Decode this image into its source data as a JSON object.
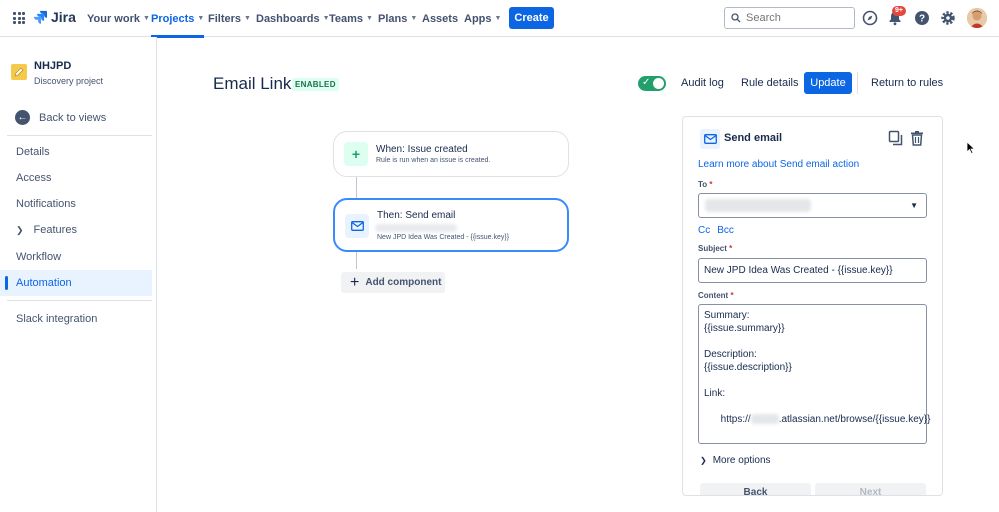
{
  "nav": {
    "brand": "Jira",
    "items": [
      {
        "label": "Your work",
        "dropdown": true
      },
      {
        "label": "Projects",
        "dropdown": true,
        "active": true
      },
      {
        "label": "Filters",
        "dropdown": true
      },
      {
        "label": "Dashboards",
        "dropdown": true
      },
      {
        "label": "Teams",
        "dropdown": true
      },
      {
        "label": "Plans",
        "dropdown": true
      },
      {
        "label": "Assets",
        "dropdown": false
      },
      {
        "label": "Apps",
        "dropdown": true
      }
    ],
    "create_label": "Create",
    "search_placeholder": "Search",
    "notification_badge": "9+",
    "icons": [
      "app-switcher-icon",
      "compass-icon",
      "bell-icon",
      "help-icon",
      "settings-icon"
    ]
  },
  "sidebar": {
    "project_name": "NHJPD",
    "project_type": "Discovery project",
    "back_label": "Back to views",
    "items": [
      {
        "label": "Details"
      },
      {
        "label": "Access"
      },
      {
        "label": "Notifications"
      },
      {
        "label": "Features",
        "expandable": true
      },
      {
        "label": "Workflow"
      },
      {
        "label": "Automation",
        "active": true
      }
    ],
    "integration_label": "Slack integration"
  },
  "rule": {
    "title": "Email Link",
    "status": "ENABLED",
    "enabled": true,
    "actions": {
      "audit_log": "Audit log",
      "rule_details": "Rule details",
      "update": "Update",
      "return": "Return to rules"
    }
  },
  "flow": {
    "trigger": {
      "title": "When: Issue created",
      "subtitle": "Rule is run when an issue is created."
    },
    "action": {
      "title": "Then: Send email",
      "subtitle": "New JPD Idea Was Created - {{issue.key}}"
    },
    "add_label": "Add component"
  },
  "panel": {
    "title": "Send email",
    "learn_more": "Learn more about Send email action",
    "to_label": "To",
    "cc_label": "Cc",
    "bcc_label": "Bcc",
    "subject_label": "Subject",
    "subject_value": "New JPD Idea Was Created - {{issue.key}}",
    "content_label": "Content",
    "content": {
      "line1": "Summary:",
      "line2": "{{issue.summary}}",
      "line3": "",
      "line4": "Description:",
      "line5": "{{issue.description}}",
      "line6": "",
      "line7": "Link:",
      "line8a": "https://",
      "line8b": ".atlassian.net/browse/{{issue.key}}"
    },
    "more_options": "More options",
    "back": "Back",
    "next": "Next"
  },
  "colors": {
    "primary": "#0c66e4",
    "success": "#22a06b",
    "danger": "#e2483d",
    "text": "#172b4d"
  }
}
